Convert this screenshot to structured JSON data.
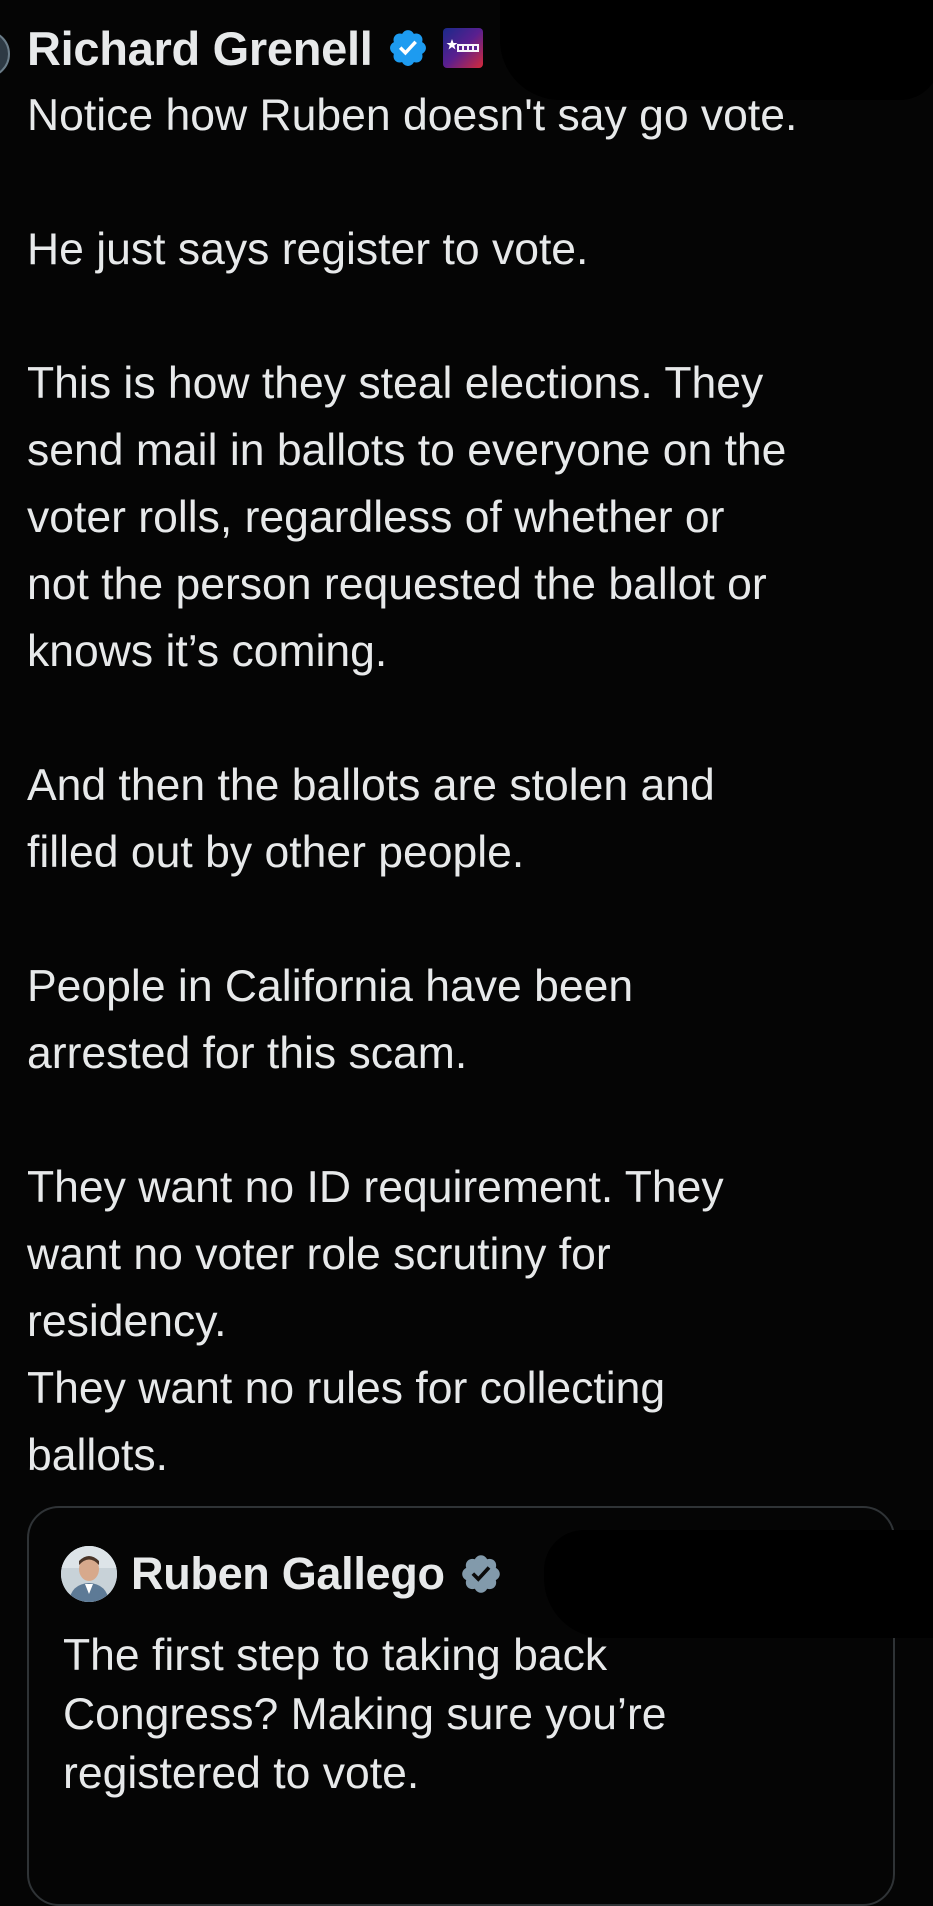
{
  "tweet": {
    "author_name": "Richard Grenell",
    "verified_icon": "verified-badge-icon",
    "affiliate_badge": "cpac-badge",
    "paragraphs": [
      [
        "Notice how Ruben doesn't say go vote."
      ],
      [
        "He just says register to vote."
      ],
      [
        "This is how they steal elections. They",
        "send mail in ballots to everyone on the",
        "voter rolls, regardless of whether or",
        "not the person requested the ballot or",
        "knows it’s coming."
      ],
      [
        "And then the ballots are stolen and",
        "filled out by other people."
      ],
      [
        "People in California have been",
        "arrested for this scam."
      ],
      [
        "They want no ID requirement. They",
        "want no voter role scrutiny for",
        "residency.",
        "They want no rules for collecting",
        "ballots."
      ]
    ]
  },
  "quoted_tweet": {
    "author_name": "Ruben Gallego",
    "verified_icon": "verified-badge-icon",
    "lines": [
      "The first step to taking back",
      "Congress? Making sure you’re",
      "registered to vote."
    ]
  },
  "colors": {
    "background": "#050505",
    "text": "#e7e9ea",
    "verified_blue": "#1d9bf0",
    "verified_gray": "#829aab",
    "card_border": "#2f3336"
  }
}
